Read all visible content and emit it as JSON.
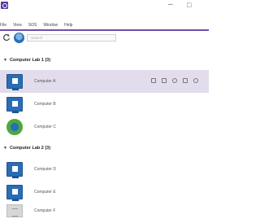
{
  "menu": {
    "items": [
      "File",
      "View",
      "SOS",
      "Window",
      "Help"
    ]
  },
  "window_controls": {
    "minimize": "–",
    "maximize": "□"
  },
  "toolbar": {
    "search_placeholder": "Search"
  },
  "groups": [
    {
      "title": "Computer Lab 1 (3)",
      "computers": [
        {
          "name": "Computer A",
          "icon": "monitor-icon",
          "selected": true
        },
        {
          "name": "Computer B",
          "icon": "monitor-icon"
        },
        {
          "name": "Computer C",
          "icon": "green-globe-icon"
        }
      ]
    },
    {
      "title": "Computer Lab 2 (3)",
      "computers": [
        {
          "name": "Computer D",
          "icon": "monitor-icon"
        },
        {
          "name": "Computer E",
          "icon": "monitor-icon"
        },
        {
          "name": "Computer F",
          "icon": "offline-monitor-icon"
        }
      ]
    }
  ],
  "colors": {
    "accent": "#6b4fb0",
    "selected_row": "#e3dcec",
    "monitor_blue": "#2a6db5"
  }
}
